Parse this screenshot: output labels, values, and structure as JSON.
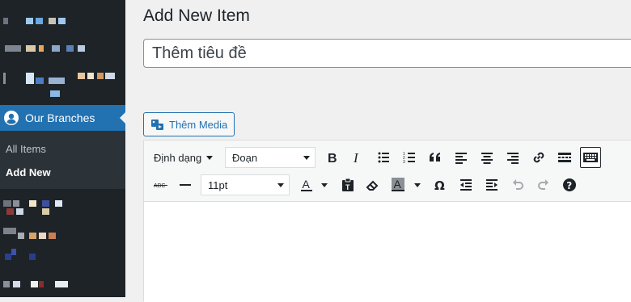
{
  "sidebar": {
    "active_menu": {
      "label": "Our Branches"
    },
    "submenu": [
      {
        "label": "All Items"
      },
      {
        "label": "Add New"
      }
    ]
  },
  "main": {
    "page_title": "Add New Item",
    "title_input": {
      "placeholder": "Thêm tiêu đề",
      "value": ""
    },
    "media_button": {
      "label": "Thêm Media"
    }
  },
  "toolbar": {
    "row1": {
      "format_menu": "Định dạng",
      "block_select": "Đoạn",
      "buttons": [
        "bold-icon",
        "italic-icon",
        "bullet-list-icon",
        "numbered-list-icon",
        "blockquote-icon",
        "align-left-icon",
        "align-center-icon",
        "align-right-icon",
        "link-icon",
        "read-more-icon",
        "toolbar-toggle-icon"
      ]
    },
    "row2": {
      "font_size": "11pt",
      "buttons": [
        "strikethrough-icon",
        "horizontal-line-icon",
        "text-color-icon",
        "paste-text-icon",
        "clear-format-icon",
        "background-color-icon",
        "special-char-icon",
        "outdent-icon",
        "indent-icon",
        "undo-icon",
        "redo-icon",
        "help-icon"
      ]
    },
    "text_color_glyph": "A",
    "bg_color_glyph": "A",
    "special_char_glyph": "Ω",
    "strikethrough_glyph": "ABC"
  },
  "colors": {
    "sidebar_bg": "#1d2327",
    "accent": "#2271b1",
    "page_bg": "#f0f0f1"
  }
}
